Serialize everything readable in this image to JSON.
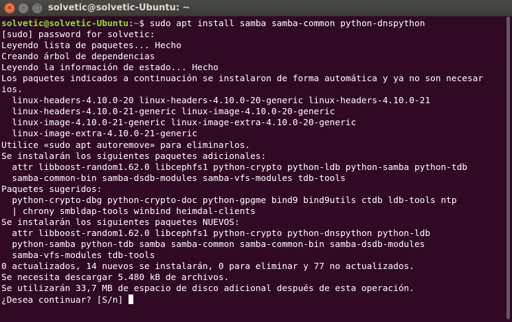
{
  "window": {
    "title": "solvetic@solvetic-Ubuntu: ~",
    "close_glyph": "×",
    "min_glyph": "–",
    "max_glyph": "□"
  },
  "prompt": {
    "user_host": "solvetic@solvetic-Ubuntu",
    "separator": ":",
    "path": "~",
    "symbol": "$ ",
    "command": "sudo apt install samba samba-common python-dnspython"
  },
  "output_lines": [
    "[sudo] password for solvetic:",
    "Leyendo lista de paquetes... Hecho",
    "Creando árbol de dependencias",
    "Leyendo la información de estado... Hecho",
    "Los paquetes indicados a continuación se instalaron de forma automática y ya no son necesar",
    "ios.",
    "  linux-headers-4.10.0-20 linux-headers-4.10.0-20-generic linux-headers-4.10.0-21",
    "  linux-headers-4.10.0-21-generic linux-image-4.10.0-20-generic",
    "  linux-image-4.10.0-21-generic linux-image-extra-4.10.0-20-generic",
    "  linux-image-extra-4.10.0-21-generic",
    "Utilice «sudo apt autoremove» para eliminarlos.",
    "Se instalarán los siguientes paquetes adicionales:",
    "  attr libboost-random1.62.0 libcephfs1 python-crypto python-ldb python-samba python-tdb",
    "  samba-common-bin samba-dsdb-modules samba-vfs-modules tdb-tools",
    "Paquetes sugeridos:",
    "  python-crypto-dbg python-crypto-doc python-gpgme bind9 bind9utils ctdb ldb-tools ntp",
    "  | chrony smbldap-tools winbind heimdal-clients",
    "Se instalarán los siguientes paquetes NUEVOS:",
    "  attr libboost-random1.62.0 libcephfs1 python-crypto python-dnspython python-ldb",
    "  python-samba python-tdb samba samba-common samba-common-bin samba-dsdb-modules",
    "  samba-vfs-modules tdb-tools",
    "0 actualizados, 14 nuevos se instalarán, 0 para eliminar y 77 no actualizados.",
    "Se necesita descargar 5.480 kB de archivos.",
    "Se utilizarán 33,7 MB de espacio de disco adicional después de esta operación.",
    "¿Desea continuar? [S/n] "
  ],
  "colors": {
    "background": "#300a24",
    "user_host": "#8ae234",
    "path": "#729fcf",
    "text": "#ffffff"
  }
}
